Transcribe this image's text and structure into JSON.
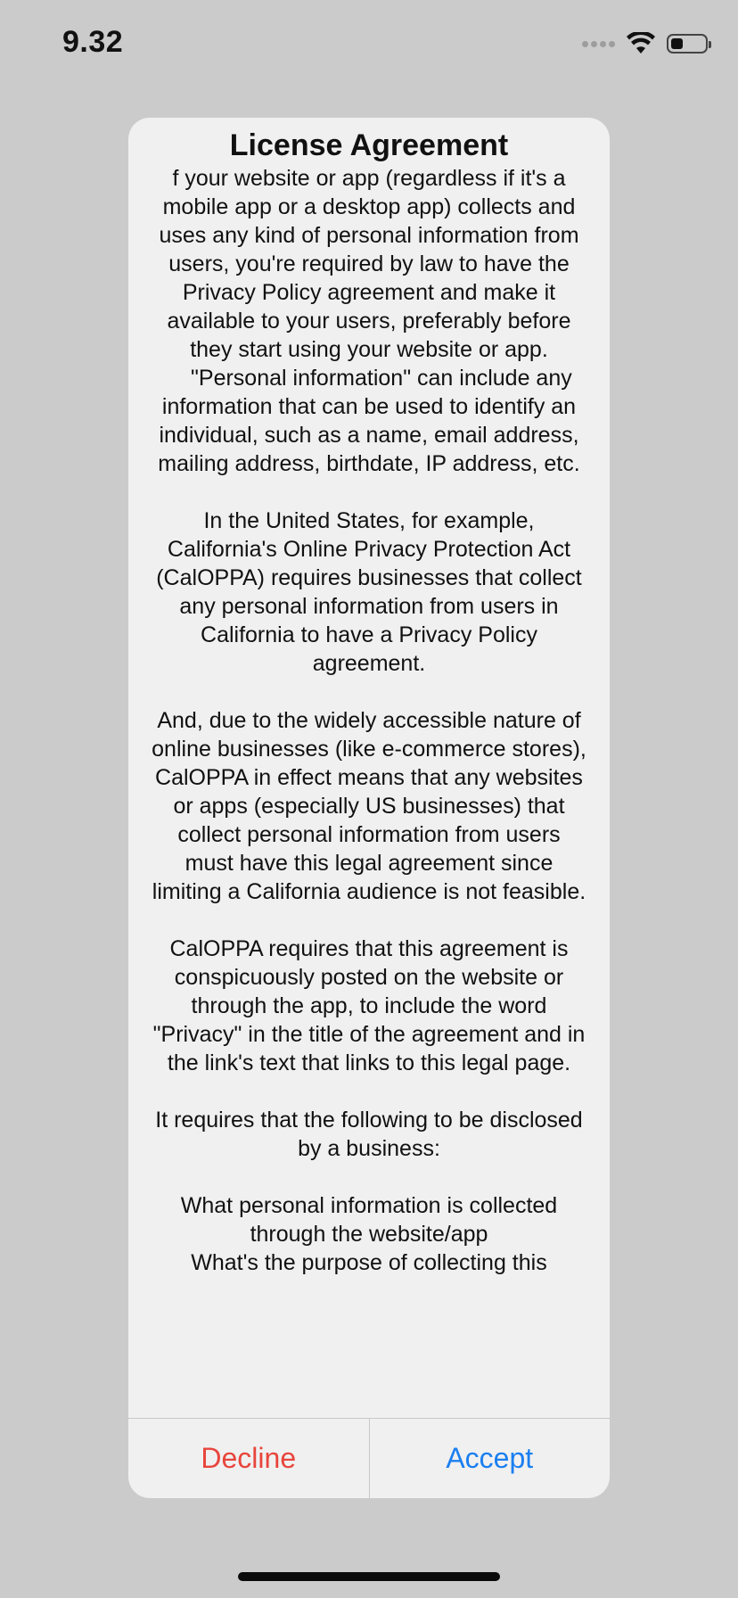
{
  "status_bar": {
    "time": "9.32",
    "signal_icon": "signal-dots-icon",
    "wifi_icon": "wifi-icon",
    "battery_icon": "battery-icon",
    "battery_level": 0.35
  },
  "dialog": {
    "title": "License Agreement",
    "body": "f your website or app (regardless if it's a mobile app or a desktop app) collects and uses any kind of personal information from users, you're required by law to have the Privacy Policy agreement and make it available to your users, preferably before they start using your website or app.\n    \"Personal information\" can include any information that can be used to identify an individual, such as a name, email address, mailing address, birthdate, IP address, etc.\n\nIn the United States, for example, California's Online Privacy Protection Act (CalOPPA) requires businesses that collect any personal information from users in California to have a Privacy Policy agreement.\n\nAnd, due to the widely accessible nature of online businesses (like e-commerce stores), CalOPPA in effect means that any websites or apps (especially US businesses) that collect personal information from users must have this legal agreement since limiting a California audience is not feasible.\n\nCalOPPA requires that this agreement is conspicuously posted on the website or through the app, to include the word \"Privacy\" in the title of the agreement and in the link's text that links to this legal page.\n\nIt requires that the following to be disclosed by a business:\n\nWhat personal information is collected through the website/app\nWhat's the purpose of collecting this",
    "decline_label": "Decline",
    "accept_label": "Accept",
    "decline_color": "#e8453c",
    "accept_color": "#1b7ff0"
  },
  "colors": {
    "backdrop": "#cbcbcb",
    "dialog_background": "#f0f0f0"
  }
}
